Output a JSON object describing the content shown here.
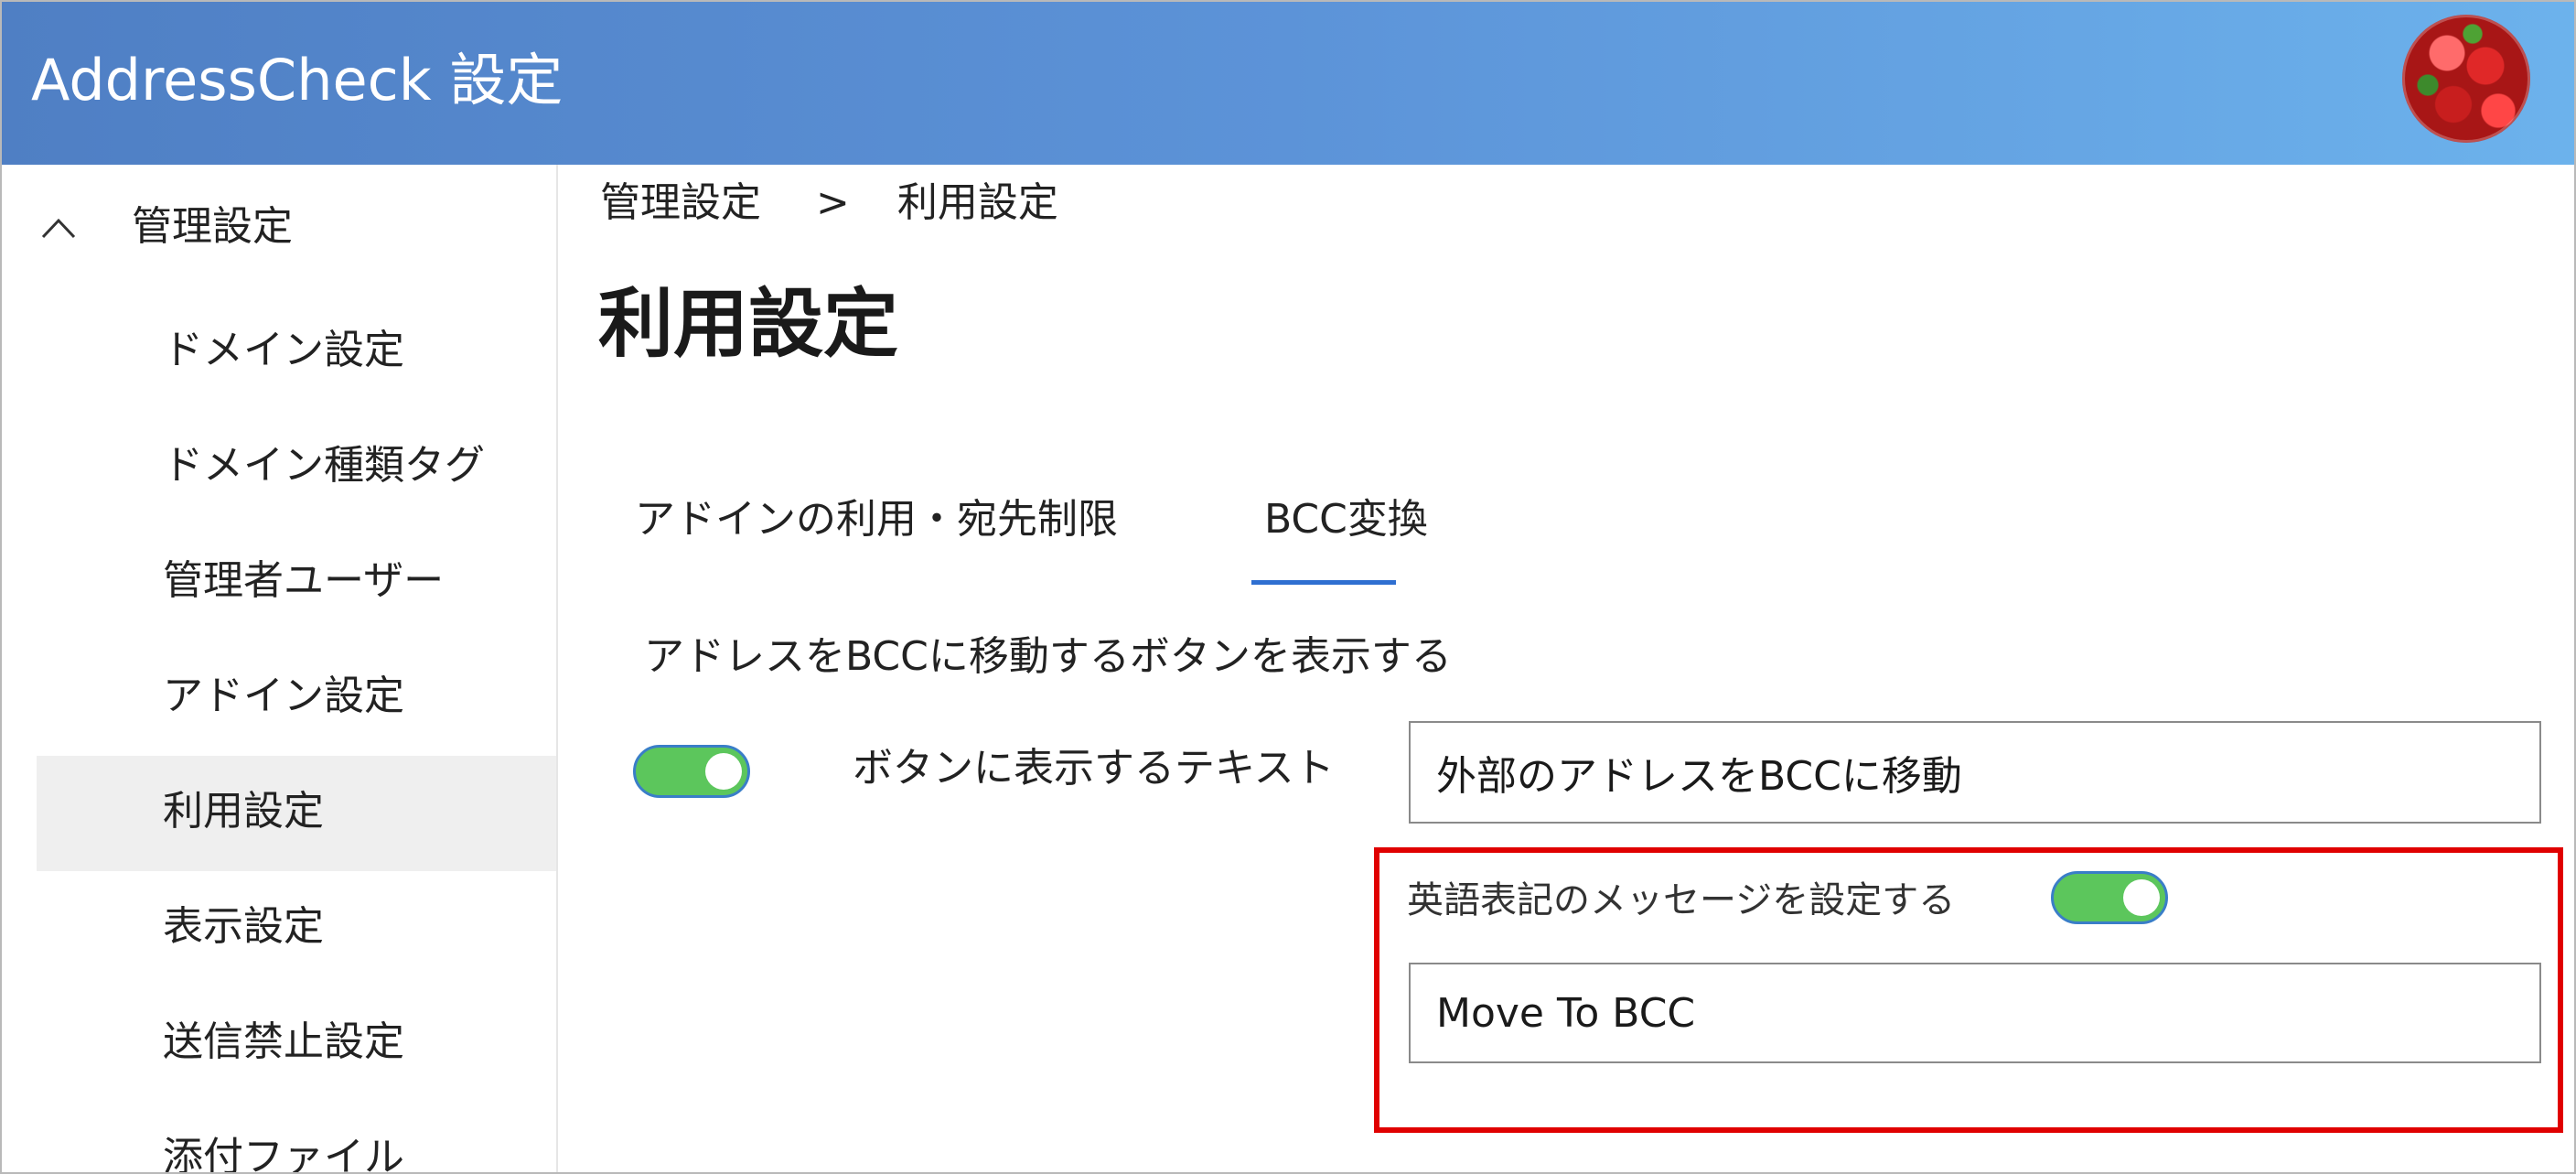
{
  "header": {
    "title": "AddressCheck 設定"
  },
  "sidebar": {
    "section_title": "管理設定",
    "items": [
      {
        "label": "ドメイン設定"
      },
      {
        "label": "ドメイン種類タグ"
      },
      {
        "label": "管理者ユーザー"
      },
      {
        "label": "アドイン設定"
      },
      {
        "label": "利用設定",
        "active": true
      },
      {
        "label": "表示設定"
      },
      {
        "label": "送信禁止設定"
      },
      {
        "label": "添付ファイル"
      }
    ]
  },
  "breadcrumb": {
    "parent": "管理設定",
    "separator": ">",
    "current": "利用設定"
  },
  "page": {
    "title": "利用設定"
  },
  "tabs": [
    {
      "label": "アドインの利用・宛先制限",
      "selected": false
    },
    {
      "label": "BCC変換",
      "selected": true
    }
  ],
  "bcc": {
    "show_button_label": "アドレスをBCCに移動するボタンを表示する",
    "show_button_toggle": true,
    "button_text_label": "ボタンに表示するテキスト",
    "button_text_value": "外部のアドレスをBCCに移動",
    "english_message_label": "英語表記のメッセージを設定する",
    "english_message_toggle": true,
    "english_message_value": "Move To BCC"
  },
  "colors": {
    "header_start": "#4f7fc4",
    "header_end": "#6cb2ec",
    "toggle_on": "#5cc65c",
    "tab_accent": "#2f6fd1",
    "highlight": "#e00000"
  }
}
